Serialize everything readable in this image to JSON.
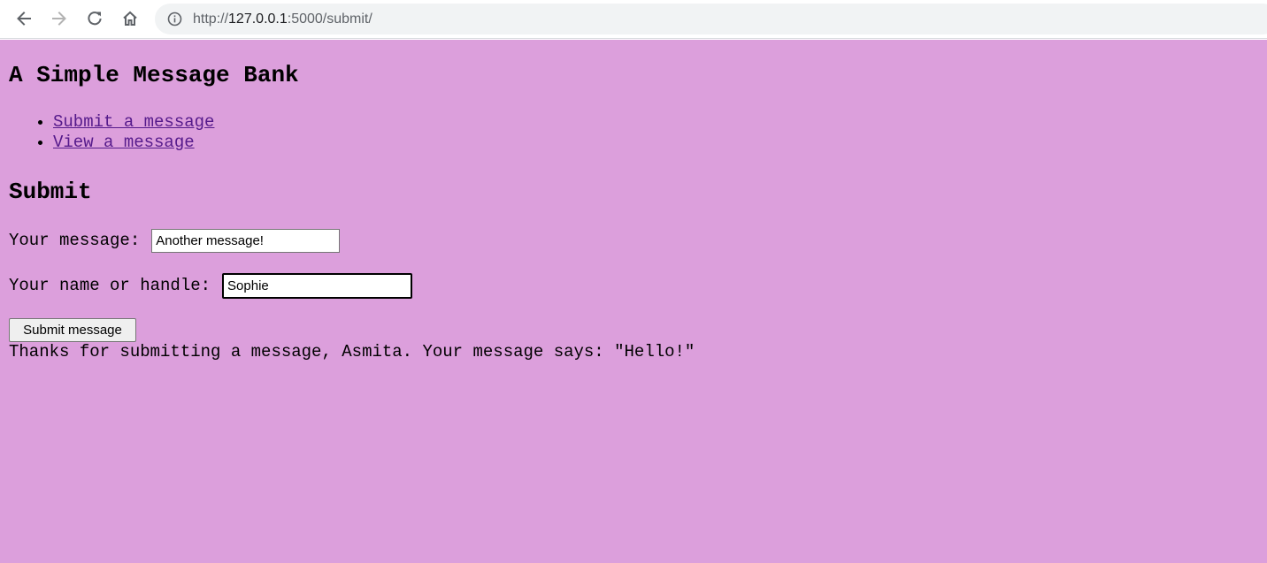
{
  "browser": {
    "url": {
      "scheme": "http://",
      "host": "127.0.0.1",
      "path": ":5000/submit/"
    },
    "icons": {
      "back": "back-arrow-icon",
      "forward": "forward-arrow-icon",
      "reload": "reload-icon",
      "home": "home-icon",
      "info": "info-icon"
    }
  },
  "page": {
    "background_color": "#dc9fdc",
    "link_color": "#551a8b",
    "title": "A Simple Message Bank",
    "nav": {
      "items": [
        {
          "label": "Submit a message"
        },
        {
          "label": "View a message"
        }
      ]
    },
    "section_title": "Submit",
    "form": {
      "message_label": "Your message:",
      "message_value": "Another message!",
      "name_label": "Your name or handle:",
      "name_value": "Sophie",
      "submit_label": "Submit message"
    },
    "confirmation": "Thanks for submitting a message, Asmita. Your message says: \"Hello!\""
  }
}
